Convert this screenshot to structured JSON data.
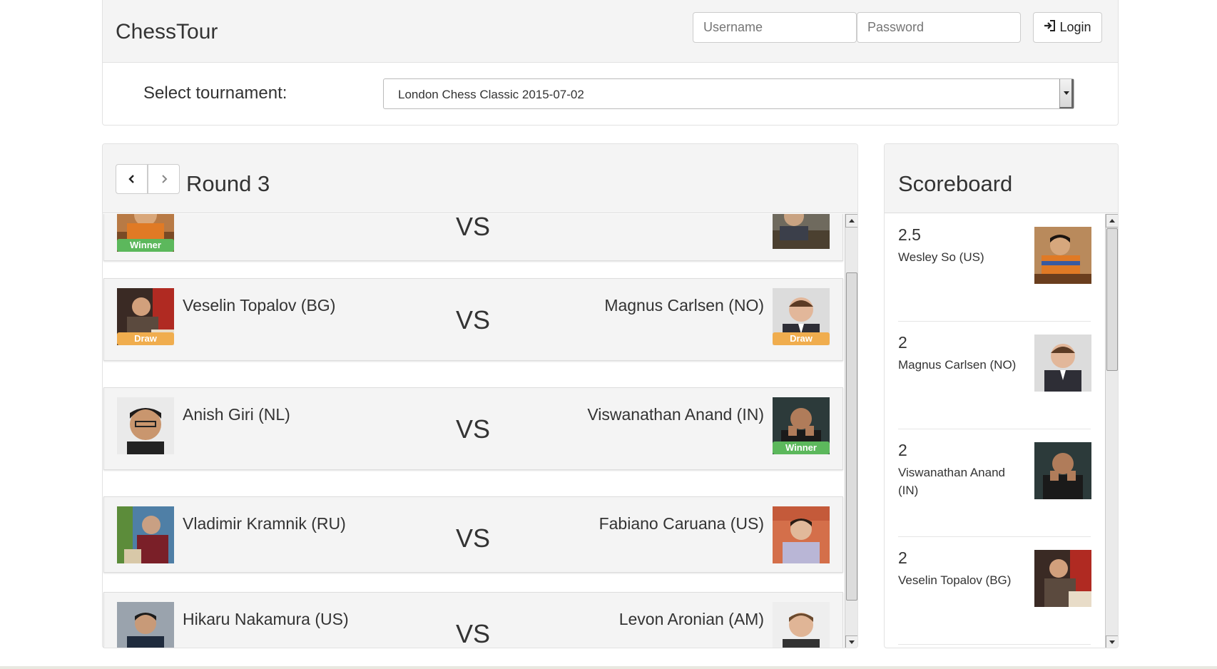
{
  "header": {
    "brand": "ChessTour",
    "username_placeholder": "Username",
    "password_placeholder": "Password",
    "login_label": "Login"
  },
  "tournament": {
    "label": "Select tournament:",
    "selected": "London Chess Classic 2015-07-02"
  },
  "round": {
    "title": "Round 3",
    "vs_label": "VS",
    "matches": [
      {
        "left_name": "",
        "left_badge": "Winner",
        "right_name": "",
        "right_badge": ""
      },
      {
        "left_name": "Veselin Topalov (BG)",
        "left_badge": "Draw",
        "right_name": "Magnus Carlsen (NO)",
        "right_badge": "Draw"
      },
      {
        "left_name": "Anish Giri (NL)",
        "left_badge": "",
        "right_name": "Viswanathan Anand (IN)",
        "right_badge": "Winner"
      },
      {
        "left_name": "Vladimir Kramnik (RU)",
        "left_badge": "",
        "right_name": "Fabiano Caruana (US)",
        "right_badge": ""
      },
      {
        "left_name": "Hikaru Nakamura (US)",
        "left_badge": "",
        "right_name": "Levon Aronian (AM)",
        "right_badge": ""
      }
    ]
  },
  "scoreboard": {
    "title": "Scoreboard",
    "entries": [
      {
        "score": "2.5",
        "name": "Wesley So (US)"
      },
      {
        "score": "2",
        "name": "Magnus Carlsen (NO)"
      },
      {
        "score": "2",
        "name": "Viswanathan Anand (IN)"
      },
      {
        "score": "2",
        "name": "Veselin Topalov (BG)"
      }
    ]
  },
  "colors": {
    "winner": "#5cb85c",
    "draw": "#f0ad4e",
    "panel_bg": "#f4f4f4"
  }
}
